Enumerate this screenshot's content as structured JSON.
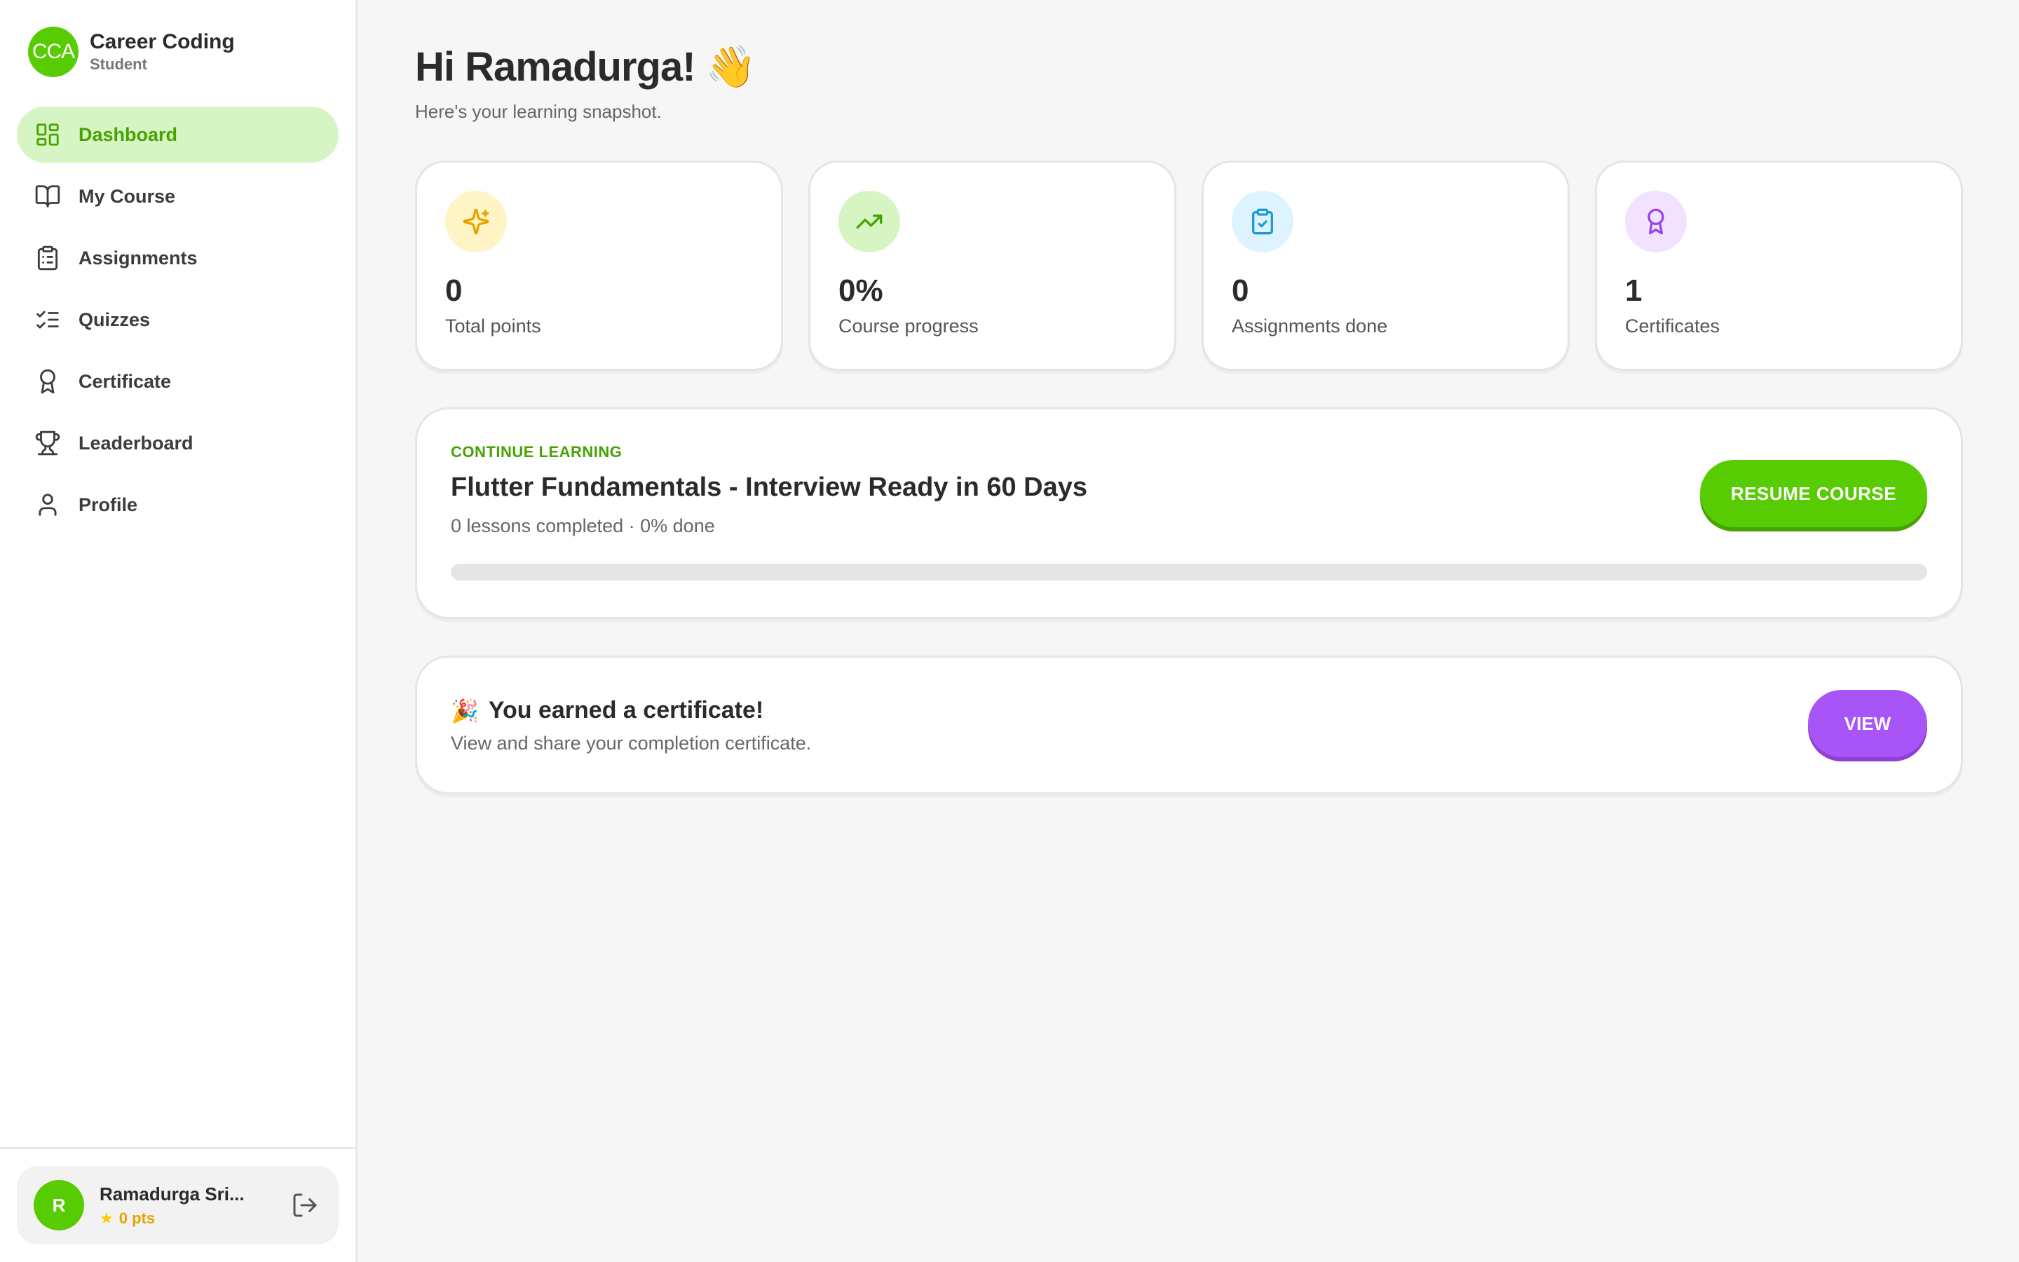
{
  "brand": {
    "logo_text": "CCA",
    "name": "Career Coding",
    "role": "Student"
  },
  "nav": {
    "items": [
      {
        "label": "Dashboard",
        "icon": "grid-icon",
        "active": true
      },
      {
        "label": "My Course",
        "icon": "book-icon"
      },
      {
        "label": "Assignments",
        "icon": "clipboard-list-icon"
      },
      {
        "label": "Quizzes",
        "icon": "checklist-icon"
      },
      {
        "label": "Certificate",
        "icon": "award-icon"
      },
      {
        "label": "Leaderboard",
        "icon": "trophy-icon"
      },
      {
        "label": "Profile",
        "icon": "user-icon"
      }
    ]
  },
  "user": {
    "initial": "R",
    "name": "Ramadurga Sri...",
    "points": "0 pts"
  },
  "header": {
    "greeting": "Hi Ramadurga! 👋",
    "subtitle": "Here's your learning snapshot."
  },
  "stats": [
    {
      "value": "0",
      "label": "Total points",
      "icon": "sparkles-icon",
      "color": "#e5a400",
      "bg": "#fff4c6"
    },
    {
      "value": "0%",
      "label": "Course progress",
      "icon": "trending-up-icon",
      "color": "#46a302",
      "bg": "#d7f5c2"
    },
    {
      "value": "0",
      "label": "Assignments done",
      "icon": "clipboard-check-icon",
      "color": "#1e9ad6",
      "bg": "#ddf3ff"
    },
    {
      "value": "1",
      "label": "Certificates",
      "icon": "award-icon",
      "color": "#9b45e4",
      "bg": "#f1e3ff"
    }
  ],
  "continue": {
    "eyebrow": "CONTINUE LEARNING",
    "title": "Flutter Fundamentals - Interview Ready in 60 Days",
    "meta": "0 lessons completed · 0% done",
    "progress": 0,
    "button": "RESUME COURSE"
  },
  "certificate": {
    "emoji": "🎉",
    "title": "You earned a certificate!",
    "subtitle": "View and share your completion certificate.",
    "button": "VIEW"
  },
  "colors": {
    "accent": "#58cc02",
    "accent_dark": "#46a302",
    "purple": "#a855f7"
  }
}
